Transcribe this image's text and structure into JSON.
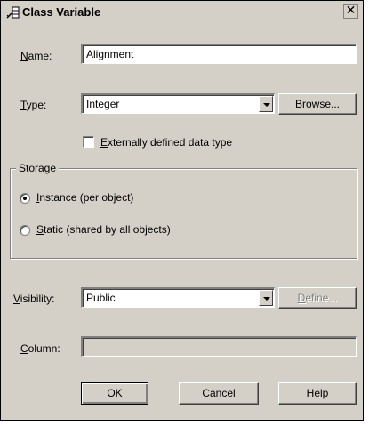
{
  "window": {
    "title": "Class Variable",
    "close_glyph": "✕"
  },
  "name": {
    "label_prefix": "N",
    "label_rest": "ame:",
    "value": "Alignment"
  },
  "type": {
    "label_prefix": "T",
    "label_rest": "ype:",
    "value": "Integer",
    "browse_prefix": "B",
    "browse_rest": "rowse..."
  },
  "external": {
    "label_prefix": "E",
    "label_rest": "xternally defined data type",
    "checked": false
  },
  "storage": {
    "title": "Storage",
    "instance_prefix": "I",
    "instance_rest": "nstance (per object)",
    "static_prefix": "S",
    "static_rest": "tatic (shared by all objects)",
    "selected": "instance"
  },
  "visibility": {
    "label_prefix": "V",
    "label_rest": "isibility:",
    "value": "Public",
    "define_prefix": "D",
    "define_rest": "efine..."
  },
  "column": {
    "label_prefix": "C",
    "label_rest": "olumn:",
    "value": ""
  },
  "buttons": {
    "ok": "OK",
    "cancel": "Cancel",
    "help": "Help"
  },
  "icons": {
    "title": "class-variable-icon"
  }
}
